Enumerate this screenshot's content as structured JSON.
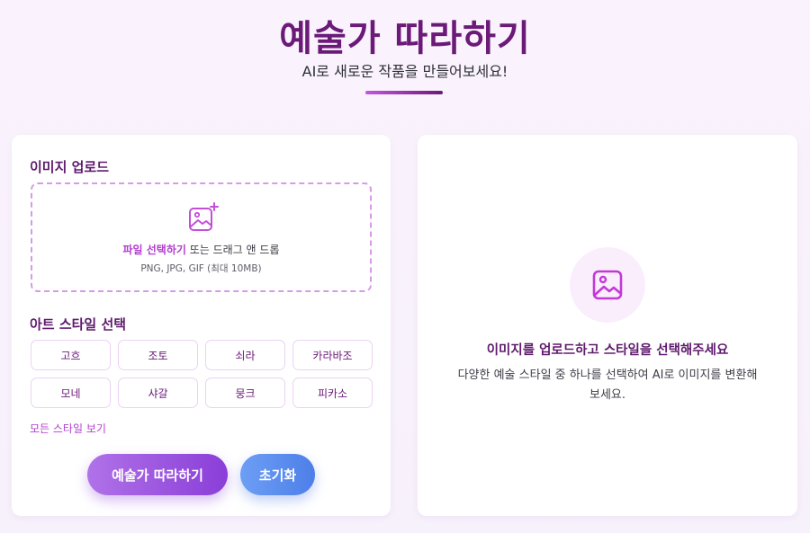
{
  "header": {
    "title": "예술가 따라하기",
    "subtitle": "AI로 새로운 작품을 만들어보세요!"
  },
  "upload": {
    "section_title": "이미지 업로드",
    "pick_link": "파일 선택하기",
    "prompt_rest": " 또는 드래그 앤 드롭",
    "formats": "PNG, JPG, GIF (최대 10MB)",
    "icon": "image-plus-icon"
  },
  "styles": {
    "section_title": "아트 스타일 선택",
    "items": [
      "고흐",
      "조토",
      "쇠라",
      "카라바조",
      "모네",
      "샤갈",
      "뭉크",
      "피카소"
    ],
    "see_all": "모든 스타일 보기"
  },
  "actions": {
    "primary_label": "예술가 따라하기",
    "reset_label": "초기화"
  },
  "preview": {
    "icon": "image-icon",
    "title": "이미지를 업로드하고 스타일을 선택해주세요",
    "description": "다양한 예술 스타일 중 하나를 선택하여 AI로 이미지를 변환해보세요."
  },
  "colors": {
    "accent": "#b23dcf",
    "title": "#6b1a78",
    "primary_button": "#8a3ed8",
    "reset_button": "#4d7fe8"
  }
}
